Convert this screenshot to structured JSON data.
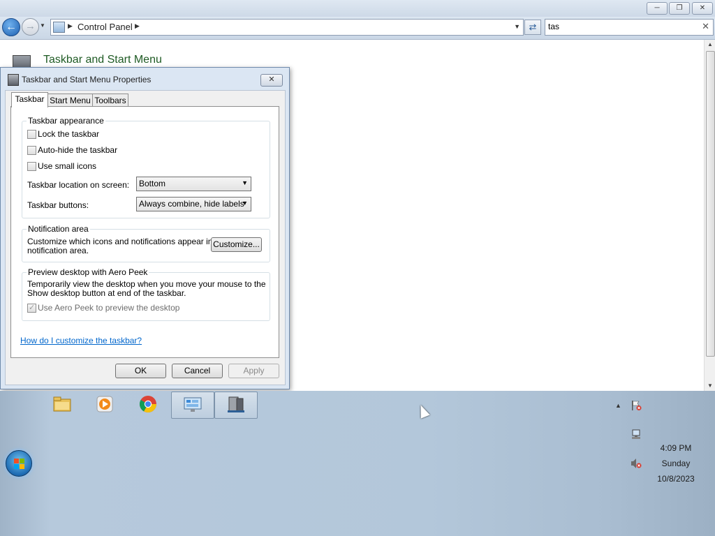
{
  "explorer": {
    "address": {
      "crumb": "Control Panel"
    },
    "search": {
      "value": "tas",
      "placeholder": ""
    },
    "page_title": "Taskbar and Start Menu",
    "caption_buttons": [
      "minimize",
      "restore",
      "close"
    ]
  },
  "dialog": {
    "title": "Taskbar and Start Menu Properties",
    "tabs": [
      {
        "label": "Taskbar",
        "active": true
      },
      {
        "label": "Start Menu",
        "active": false
      },
      {
        "label": "Toolbars",
        "active": false
      }
    ],
    "appearance": {
      "title": "Taskbar appearance",
      "lock": {
        "label": "Lock the taskbar",
        "checked": false
      },
      "autohide": {
        "label": "Auto-hide the taskbar",
        "checked": false
      },
      "small_icons": {
        "label": "Use small icons",
        "checked": false
      },
      "location_label": "Taskbar location on screen:",
      "location_value": "Bottom",
      "buttons_label": "Taskbar buttons:",
      "buttons_value": "Always combine, hide labels"
    },
    "notification": {
      "title": "Notification area",
      "text_line1": "Customize which icons and notifications appear in the",
      "text_line2": "notification area.",
      "customize_label": "Customize..."
    },
    "aero_peek": {
      "title": "Preview desktop with Aero Peek",
      "text_line1": "Temporarily view the desktop when you move your mouse to the",
      "text_line2": "Show desktop button at end of the taskbar.",
      "checkbox": {
        "label": "Use Aero Peek to preview the desktop",
        "checked": true,
        "enabled": false
      }
    },
    "help_link": "How do I customize the taskbar?",
    "buttons": {
      "ok": "OK",
      "cancel": "Cancel",
      "apply": "Apply"
    }
  },
  "taskbar": {
    "pinned": [
      {
        "name": "Windows Explorer",
        "icon": "folder-icon",
        "open": false
      },
      {
        "name": "Windows Media Player",
        "icon": "media-player-icon",
        "open": false
      },
      {
        "name": "Google Chrome",
        "icon": "chrome-icon",
        "open": false
      },
      {
        "name": "Control Panel",
        "icon": "control-panel-icon",
        "open": true
      },
      {
        "name": "Taskbar and Start Menu Properties",
        "icon": "taskbar-properties-icon",
        "open": true
      }
    ],
    "tray": {
      "icons": [
        "action-center-flag-icon",
        "network-icon",
        "volume-muted-icon"
      ],
      "time": "4:09 PM",
      "day": "Sunday",
      "date": "10/8/2023"
    }
  },
  "colors": {
    "link": "#0066cc",
    "page_title": "#1e5a23",
    "dialog_frame": "#dbe6f3"
  }
}
